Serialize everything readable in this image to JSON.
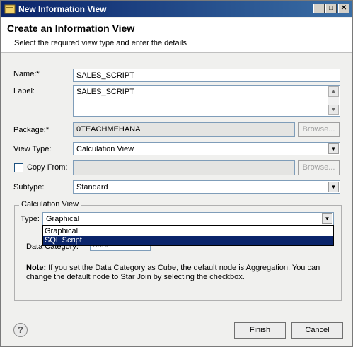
{
  "window": {
    "title": "New Information View",
    "buttons": {
      "minimize": "_",
      "maximize": "□",
      "close": "✕"
    }
  },
  "banner": {
    "heading": "Create an Information View",
    "subtitle": "Select the required view type and enter the details"
  },
  "form": {
    "name_label": "Name:*",
    "name_value": "SALES_SCRIPT",
    "label_label": "Label:",
    "label_value": "SALES_SCRIPT",
    "package_label": "Package:*",
    "package_value": "0TEACHMEHANA",
    "browse_label": "Browse...",
    "view_type_label": "View Type:",
    "view_type_value": "Calculation View",
    "copy_from_label": "Copy From:",
    "copy_from_value": "",
    "copy_from_checked": false,
    "subtype_label": "Subtype:",
    "subtype_value": "Standard"
  },
  "calc_group": {
    "legend": "Calculation View",
    "type_label": "Type:",
    "type_value": "Graphical",
    "type_options": [
      "Graphical",
      "SQL Script"
    ],
    "highlighted_option": "SQL Script",
    "data_category_label": "Data Category:",
    "data_category_value": "CUBE",
    "note_label": "Note:",
    "note_text": "If you set the Data Category as Cube, the default node is Aggregation. You can change the default node to Star Join by selecting the checkbox."
  },
  "footer": {
    "help": "?",
    "finish_label": "Finish",
    "cancel_label": "Cancel"
  }
}
